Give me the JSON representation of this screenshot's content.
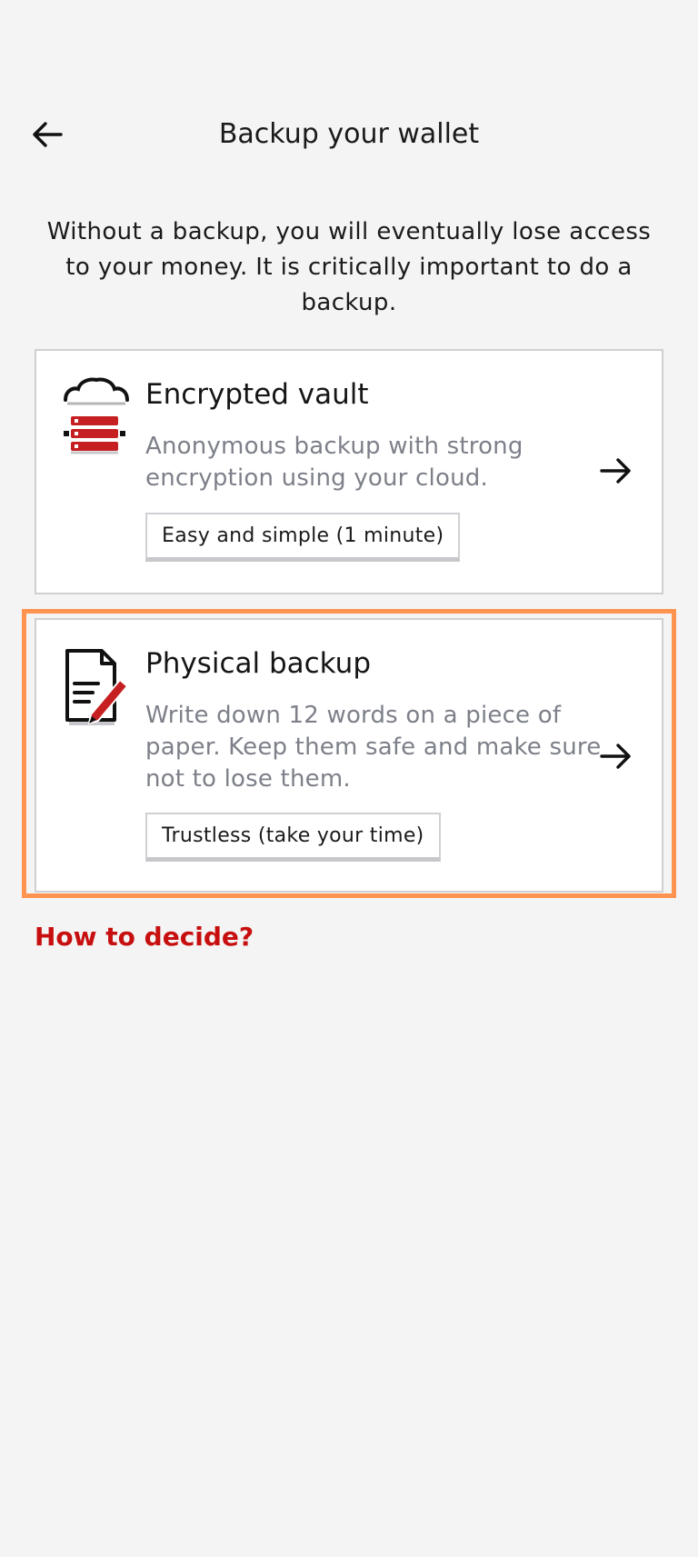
{
  "header": {
    "title": "Backup your wallet",
    "back_icon": "arrow-left-icon"
  },
  "intro": {
    "text": "Without a backup, you will eventually lose access to your money. It is critically important to do a backup."
  },
  "options": [
    {
      "title": "Encrypted vault",
      "description": "Anonymous backup with strong encryption using your cloud.",
      "tag": "Easy and simple (1 minute)",
      "icon": "cloud-server-icon"
    },
    {
      "title": "Physical backup",
      "description": "Write down 12 words on a piece of paper. Keep them safe and make sure not to lose them.",
      "tag": "Trustless (take your time)",
      "icon": "paper-pencil-icon"
    }
  ],
  "link": {
    "label": "How to decide?"
  },
  "colors": {
    "background": "#f4f4f4",
    "accent_red": "#c80f0f",
    "highlight": "#ff9450",
    "muted_text": "#7d8089"
  }
}
